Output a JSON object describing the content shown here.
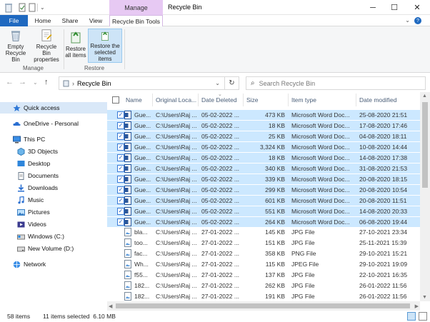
{
  "window": {
    "title": "Recycle Bin",
    "context_group": "Manage",
    "controls": [
      "─",
      "☐",
      "✕"
    ]
  },
  "tabs": [
    "File",
    "Home",
    "Share",
    "View",
    "Recycle Bin Tools"
  ],
  "ribbon": {
    "buttons": [
      {
        "label": "Empty Recycle Bin"
      },
      {
        "label": "Recycle Bin properties"
      },
      {
        "label": "Restore all items"
      },
      {
        "label": "Restore the selected items"
      }
    ],
    "groups": [
      "Manage",
      "Restore"
    ]
  },
  "address": {
    "path": "Recycle Bin",
    "search_placeholder": "Search Recycle Bin"
  },
  "nav": [
    {
      "label": "Quick access",
      "selected": true
    },
    {
      "label": "OneDrive - Personal"
    },
    {
      "label": "This PC"
    },
    {
      "label": "3D Objects"
    },
    {
      "label": "Desktop"
    },
    {
      "label": "Documents"
    },
    {
      "label": "Downloads"
    },
    {
      "label": "Music"
    },
    {
      "label": "Pictures"
    },
    {
      "label": "Videos"
    },
    {
      "label": "Windows (C:)"
    },
    {
      "label": "New Volume (D:)"
    },
    {
      "label": "Network"
    }
  ],
  "columns": [
    "Name",
    "Original Loca...",
    "Date Deleted",
    "Size",
    "Item type",
    "Date modified"
  ],
  "rows": [
    {
      "name": "Gue...",
      "loc": "C:\\Users\\Raj ...",
      "deleted": "05-02-2022 ...",
      "size": "473 KB",
      "type": "Microsoft Word Doc...",
      "modified": "25-08-2020 21:51",
      "selected": true,
      "kind": "doc"
    },
    {
      "name": "Gue...",
      "loc": "C:\\Users\\Raj ...",
      "deleted": "05-02-2022 ...",
      "size": "18 KB",
      "type": "Microsoft Word Doc...",
      "modified": "17-08-2020 17:46",
      "selected": true,
      "kind": "doc"
    },
    {
      "name": "Gue...",
      "loc": "C:\\Users\\Raj ...",
      "deleted": "05-02-2022 ...",
      "size": "25 KB",
      "type": "Microsoft Word Doc...",
      "modified": "04-08-2020 18:11",
      "selected": true,
      "kind": "doc"
    },
    {
      "name": "Gue...",
      "loc": "C:\\Users\\Raj ...",
      "deleted": "05-02-2022 ...",
      "size": "3,324 KB",
      "type": "Microsoft Word Doc...",
      "modified": "10-08-2020 14:44",
      "selected": true,
      "kind": "doc"
    },
    {
      "name": "Gue...",
      "loc": "C:\\Users\\Raj ...",
      "deleted": "05-02-2022 ...",
      "size": "18 KB",
      "type": "Microsoft Word Doc...",
      "modified": "14-08-2020 17:38",
      "selected": true,
      "kind": "doc"
    },
    {
      "name": "Gue...",
      "loc": "C:\\Users\\Raj ...",
      "deleted": "05-02-2022 ...",
      "size": "340 KB",
      "type": "Microsoft Word Doc...",
      "modified": "31-08-2020 21:53",
      "selected": true,
      "kind": "doc"
    },
    {
      "name": "Gue...",
      "loc": "C:\\Users\\Raj ...",
      "deleted": "05-02-2022 ...",
      "size": "339 KB",
      "type": "Microsoft Word Doc...",
      "modified": "20-08-2020 18:15",
      "selected": true,
      "kind": "doc"
    },
    {
      "name": "Gue...",
      "loc": "C:\\Users\\Raj ...",
      "deleted": "05-02-2022 ...",
      "size": "299 KB",
      "type": "Microsoft Word Doc...",
      "modified": "20-08-2020 10:54",
      "selected": true,
      "kind": "doc"
    },
    {
      "name": "Gue...",
      "loc": "C:\\Users\\Raj ...",
      "deleted": "05-02-2022 ...",
      "size": "601 KB",
      "type": "Microsoft Word Doc...",
      "modified": "20-08-2020 11:51",
      "selected": true,
      "kind": "doc"
    },
    {
      "name": "Gue...",
      "loc": "C:\\Users\\Raj ...",
      "deleted": "05-02-2022 ...",
      "size": "551 KB",
      "type": "Microsoft Word Doc...",
      "modified": "14-08-2020 20:33",
      "selected": true,
      "kind": "doc"
    },
    {
      "name": "Gue...",
      "loc": "C:\\Users\\Raj ...",
      "deleted": "05-02-2022 ...",
      "size": "264 KB",
      "type": "Microsoft Word Doc...",
      "modified": "06-08-2020 19:44",
      "selected": true,
      "kind": "doc"
    },
    {
      "name": "bla...",
      "loc": "C:\\Users\\Raj ...",
      "deleted": "27-01-2022 ...",
      "size": "145 KB",
      "type": "JPG File",
      "modified": "27-10-2021 23:34",
      "selected": false,
      "kind": "img"
    },
    {
      "name": "too...",
      "loc": "C:\\Users\\Raj ...",
      "deleted": "27-01-2022 ...",
      "size": "151 KB",
      "type": "JPG File",
      "modified": "25-11-2021 15:39",
      "selected": false,
      "kind": "img"
    },
    {
      "name": "fac...",
      "loc": "C:\\Users\\Raj ...",
      "deleted": "27-01-2022 ...",
      "size": "358 KB",
      "type": "PNG File",
      "modified": "29-10-2021 15:21",
      "selected": false,
      "kind": "img"
    },
    {
      "name": "Wh...",
      "loc": "C:\\Users\\Raj ...",
      "deleted": "27-01-2022 ...",
      "size": "115 KB",
      "type": "JPEG File",
      "modified": "29-10-2021 19:09",
      "selected": false,
      "kind": "img"
    },
    {
      "name": "f55...",
      "loc": "C:\\Users\\Raj ...",
      "deleted": "27-01-2022 ...",
      "size": "137 KB",
      "type": "JPG File",
      "modified": "22-10-2021 16:35",
      "selected": false,
      "kind": "img"
    },
    {
      "name": "182...",
      "loc": "C:\\Users\\Raj ...",
      "deleted": "27-01-2022 ...",
      "size": "262 KB",
      "type": "JPG File",
      "modified": "26-01-2022 11:56",
      "selected": false,
      "kind": "img"
    },
    {
      "name": "182...",
      "loc": "C:\\Users\\Raj ...",
      "deleted": "27-01-2022 ...",
      "size": "191 KB",
      "type": "JPG File",
      "modified": "26-01-2022 11:56",
      "selected": false,
      "kind": "img"
    }
  ],
  "status": {
    "count": "58 items",
    "selection": "11 items selected  6.10 MB"
  },
  "colors": {
    "accent": "#1f69c0",
    "selection": "#cce8ff",
    "manage_context": "#e7c9f3"
  },
  "icons": {
    "glyph_up": "↑",
    "glyph_back": "←",
    "glyph_forward": "→",
    "glyph_refresh": "↻",
    "glyph_search": "⌕",
    "glyph_chevron": "›",
    "glyph_down": "⌄",
    "glyph_check": "✓",
    "glyph_help": "?"
  }
}
